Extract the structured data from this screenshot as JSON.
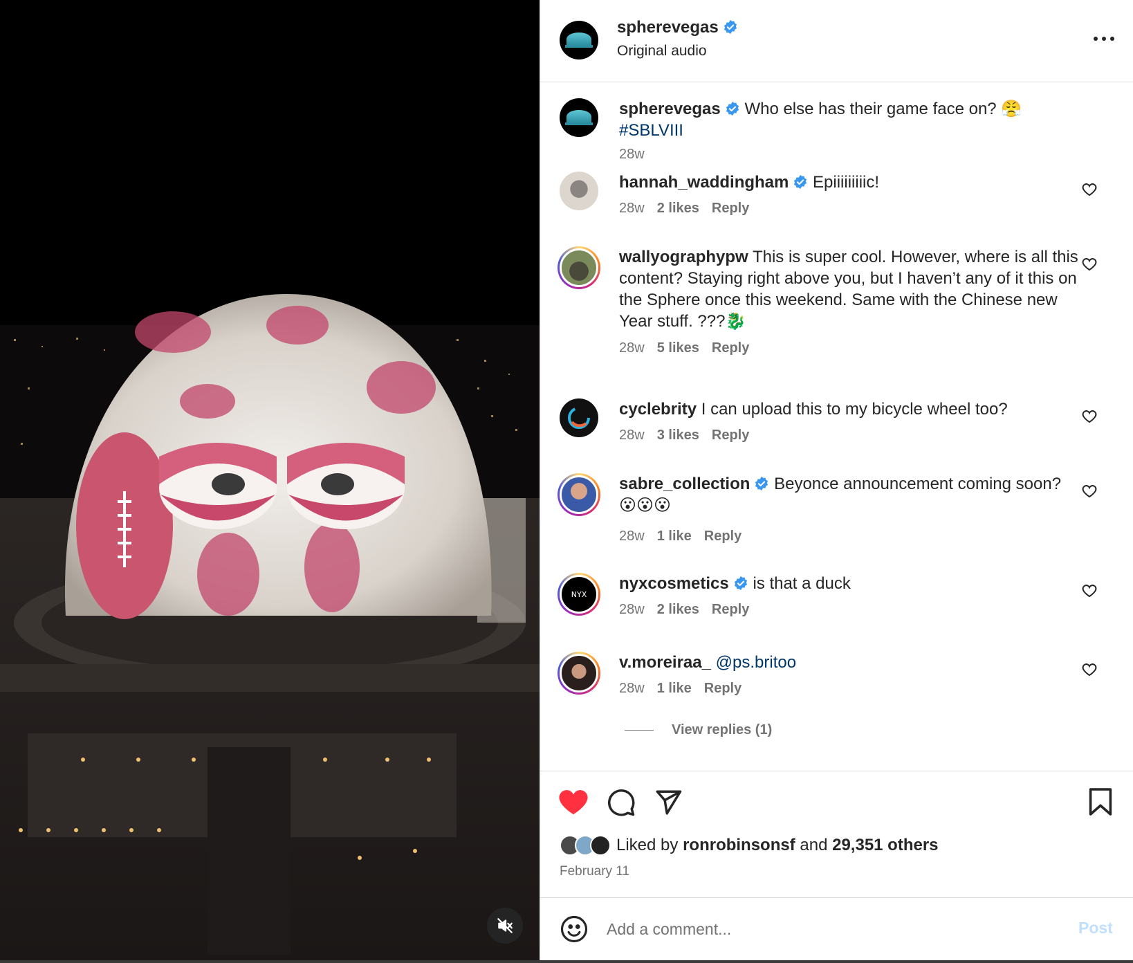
{
  "header": {
    "username": "spherevegas",
    "subtitle": "Original audio",
    "more_icon": "more-horizontal-icon"
  },
  "caption": {
    "username": "spherevegas",
    "text": "Who else has their game face on? 😤",
    "hashtag": "#SBLVIII",
    "time": "28w"
  },
  "comments": [
    {
      "username": "hannah_waddingham",
      "verified": true,
      "text": "Epiiiiiiiiic!",
      "time": "28w",
      "likes": "2 likes",
      "reply": "Reply"
    },
    {
      "username": "wallyographypw",
      "verified": false,
      "text": "This is super cool. However, where is all this content? Staying right above you, but I haven’t any of it this on the Sphere once this weekend. Same with the Chinese new Year stuff. ???🐉",
      "time": "28w",
      "likes": "5 likes",
      "reply": "Reply"
    },
    {
      "username": "cyclebrity",
      "verified": false,
      "text": "I can upload this to my bicycle wheel too?",
      "time": "28w",
      "likes": "3 likes",
      "reply": "Reply"
    },
    {
      "username": "sabre_collection",
      "verified": true,
      "text": "Beyonce announcement coming soon? 😮😮😮",
      "time": "28w",
      "likes": "1 like",
      "reply": "Reply"
    },
    {
      "username": "nyxcosmetics",
      "verified": true,
      "text": "is that a duck",
      "time": "28w",
      "likes": "2 likes",
      "reply": "Reply"
    },
    {
      "username": "v.moreiraa_",
      "verified": false,
      "mention": "@ps.britoo",
      "time": "28w",
      "likes": "1 like",
      "reply": "Reply",
      "view_replies": "View replies (1)"
    }
  ],
  "actions": {
    "liked_by_prefix": "Liked by",
    "liked_by_user": "ronrobinsonsf",
    "liked_by_and": "and",
    "liked_by_count": "29,351 others",
    "date": "February 11"
  },
  "add_comment": {
    "placeholder": "Add a comment...",
    "post_label": "Post"
  },
  "colors": {
    "like_red": "#ff3040",
    "verified_blue": "#3897f0",
    "link_blue": "#00376b",
    "muted_gray": "#737373",
    "post_disabled": "#c0dffd"
  }
}
